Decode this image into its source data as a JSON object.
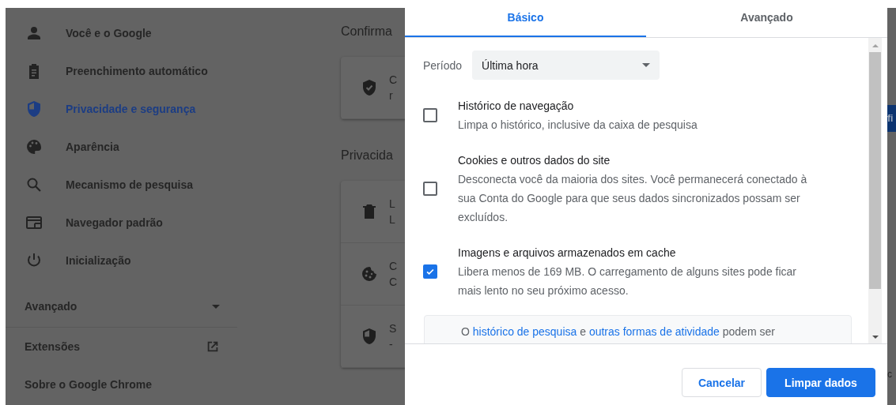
{
  "sidebar": {
    "items": [
      {
        "label": "Você e o Google",
        "kind": "person",
        "selected": false
      },
      {
        "label": "Preenchimento automático",
        "kind": "clipboard",
        "selected": false
      },
      {
        "label": "Privacidade e segurança",
        "kind": "shield",
        "selected": true
      },
      {
        "label": "Aparência",
        "kind": "palette",
        "selected": false
      },
      {
        "label": "Mecanismo de pesquisa",
        "kind": "search",
        "selected": false
      },
      {
        "label": "Navegador padrão",
        "kind": "browser",
        "selected": false
      },
      {
        "label": "Inicialização",
        "kind": "power",
        "selected": false
      }
    ],
    "advanced": {
      "label": "Avançado",
      "expanded": false
    },
    "links": [
      {
        "label": "Extensões",
        "external": true
      },
      {
        "label": "Sobre o Google Chrome",
        "external": false
      }
    ]
  },
  "background": {
    "sections": [
      {
        "heading": "Confirma",
        "rows": [
          {
            "kind": "shield-check",
            "title": "C",
            "subtitle": "r"
          }
        ]
      },
      {
        "heading": "Privacida",
        "rows": [
          {
            "kind": "trash",
            "title": "L",
            "subtitle": "L"
          },
          {
            "kind": "cookie",
            "title": "C",
            "subtitle": "C"
          },
          {
            "kind": "shield",
            "title": "S",
            "subtitle": "-"
          }
        ]
      }
    ],
    "edge_button": {
      "label": "fi"
    },
    "edge_text": "c"
  },
  "dialog": {
    "tabs": [
      {
        "label": "Básico",
        "selected": true
      },
      {
        "label": "Avançado",
        "selected": false
      }
    ],
    "period": {
      "label": "Período",
      "value": "Última hora"
    },
    "options": [
      {
        "title": "Histórico de navegação",
        "description": "Limpa o histórico, inclusive da caixa de pesquisa",
        "checked": false
      },
      {
        "title": "Cookies e outros dados do site",
        "description": "Desconecta você da maioria dos sites. Você permanecerá conectado à sua Conta do Google para que seus dados sincronizados possam ser excluídos.",
        "checked": false
      },
      {
        "title": "Imagens e arquivos armazenados em cache",
        "description": "Libera menos de 169 MB. O carregamento de alguns sites pode ficar mais lento no seu próximo acesso.",
        "checked": true
      }
    ],
    "info": [
      {
        "kind": "text",
        "text": "O "
      },
      {
        "kind": "link",
        "text": "histórico de pesquisa"
      },
      {
        "kind": "text",
        "text": " e "
      },
      {
        "kind": "link",
        "text": "outras formas de atividade"
      },
      {
        "kind": "text",
        "text": " podem ser"
      }
    ],
    "buttons": [
      {
        "label": "Cancelar",
        "kind": "secondary"
      },
      {
        "label": "Limpar dados",
        "kind": "primary"
      }
    ]
  }
}
